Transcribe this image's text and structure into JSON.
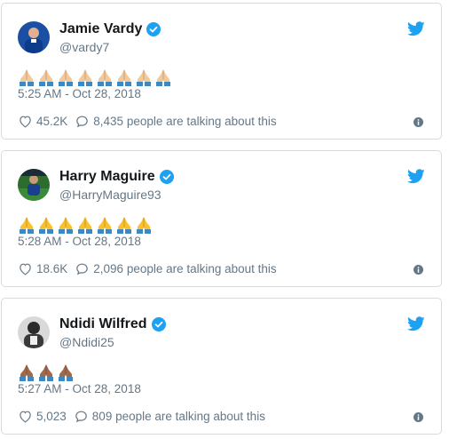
{
  "colors": {
    "twitter_blue": "#1da1f2",
    "text_secondary": "#657786",
    "border": "#d6dbe0"
  },
  "tweets": [
    {
      "name": "Jamie Vardy",
      "handle": "@vardy7",
      "emoji": "folded-hands-light",
      "emoji_count": 8,
      "emoji_skin": "#f4c99a",
      "time": "5:25 AM - Oct 28, 2018",
      "likes": "45.2K",
      "talking": "8,435 people are talking about this",
      "avatar_icon": "avatar-blue-kit"
    },
    {
      "name": "Harry Maguire",
      "handle": "@HarryMaguire93",
      "emoji": "folded-hands-yellow",
      "emoji_count": 7,
      "emoji_skin": "#fbc02d",
      "time": "5:28 AM - Oct 28, 2018",
      "likes": "18.6K",
      "talking": "2,096 people are talking about this",
      "avatar_icon": "avatar-pitch"
    },
    {
      "name": "Ndidi Wilfred",
      "handle": "@Ndidi25",
      "emoji": "folded-hands-dark",
      "emoji_count": 3,
      "emoji_skin": "#a0694b",
      "time": "5:27 AM - Oct 28, 2018",
      "likes": "5,023",
      "talking": "809 people are talking about this",
      "avatar_icon": "avatar-bw"
    }
  ]
}
